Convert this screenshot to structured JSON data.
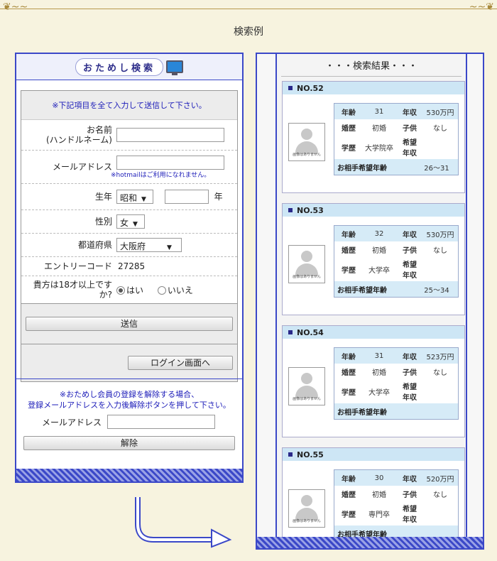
{
  "page_title": "検索例",
  "left": {
    "header_title": "おためし検索",
    "notice": "※下記項目を全て入力して送信して下さい。",
    "fields": {
      "name_label_1": "お名前",
      "name_label_2": "(ハンドルネーム)",
      "email_label": "メールアドレス",
      "email_hint": "※hotmailはご利用になれません。",
      "birth_label": "生年",
      "era": "昭和",
      "year_unit": "年",
      "gender_label": "性別",
      "gender": "女",
      "pref_label": "都道府県",
      "pref": "大阪府",
      "entry_label": "エントリーコード",
      "entry_code": "27285",
      "age_label_1": "貴方は18才以上です",
      "age_label_2": "か?",
      "yes": "はい",
      "no": "いいえ"
    },
    "submit": "送信",
    "login": "ログイン画面へ",
    "unreg_note_1": "※おためし会員の登録を解除する場合、",
    "unreg_note_2": "登録メールアドレスを入力後解除ボタンを押して下さい。",
    "unreg_email_label": "メールアドレス",
    "cancel": "解除"
  },
  "right": {
    "results_title": "・・・検索結果・・・",
    "labels": {
      "age": "年齢",
      "income": "年収",
      "marriage": "婚歴",
      "children": "子供",
      "education": "学歴",
      "wish_1": "希望",
      "wish_2": "年収",
      "partner_age": "お相手希望年齢",
      "no_photo": "画像はありません"
    },
    "cards": [
      {
        "no": "NO.52",
        "age": "31",
        "income": "530万円",
        "marriage": "初婚",
        "children": "なし",
        "education": "大学院卒",
        "partner_age": "26〜31"
      },
      {
        "no": "NO.53",
        "age": "32",
        "income": "530万円",
        "marriage": "初婚",
        "children": "なし",
        "education": "大学卒",
        "partner_age": "25〜34"
      },
      {
        "no": "NO.54",
        "age": "31",
        "income": "523万円",
        "marriage": "初婚",
        "children": "なし",
        "education": "大学卒",
        "partner_age": ""
      },
      {
        "no": "NO.55",
        "age": "30",
        "income": "520万円",
        "marriage": "初婚",
        "children": "なし",
        "education": "専門卒",
        "partner_age": ""
      }
    ]
  }
}
